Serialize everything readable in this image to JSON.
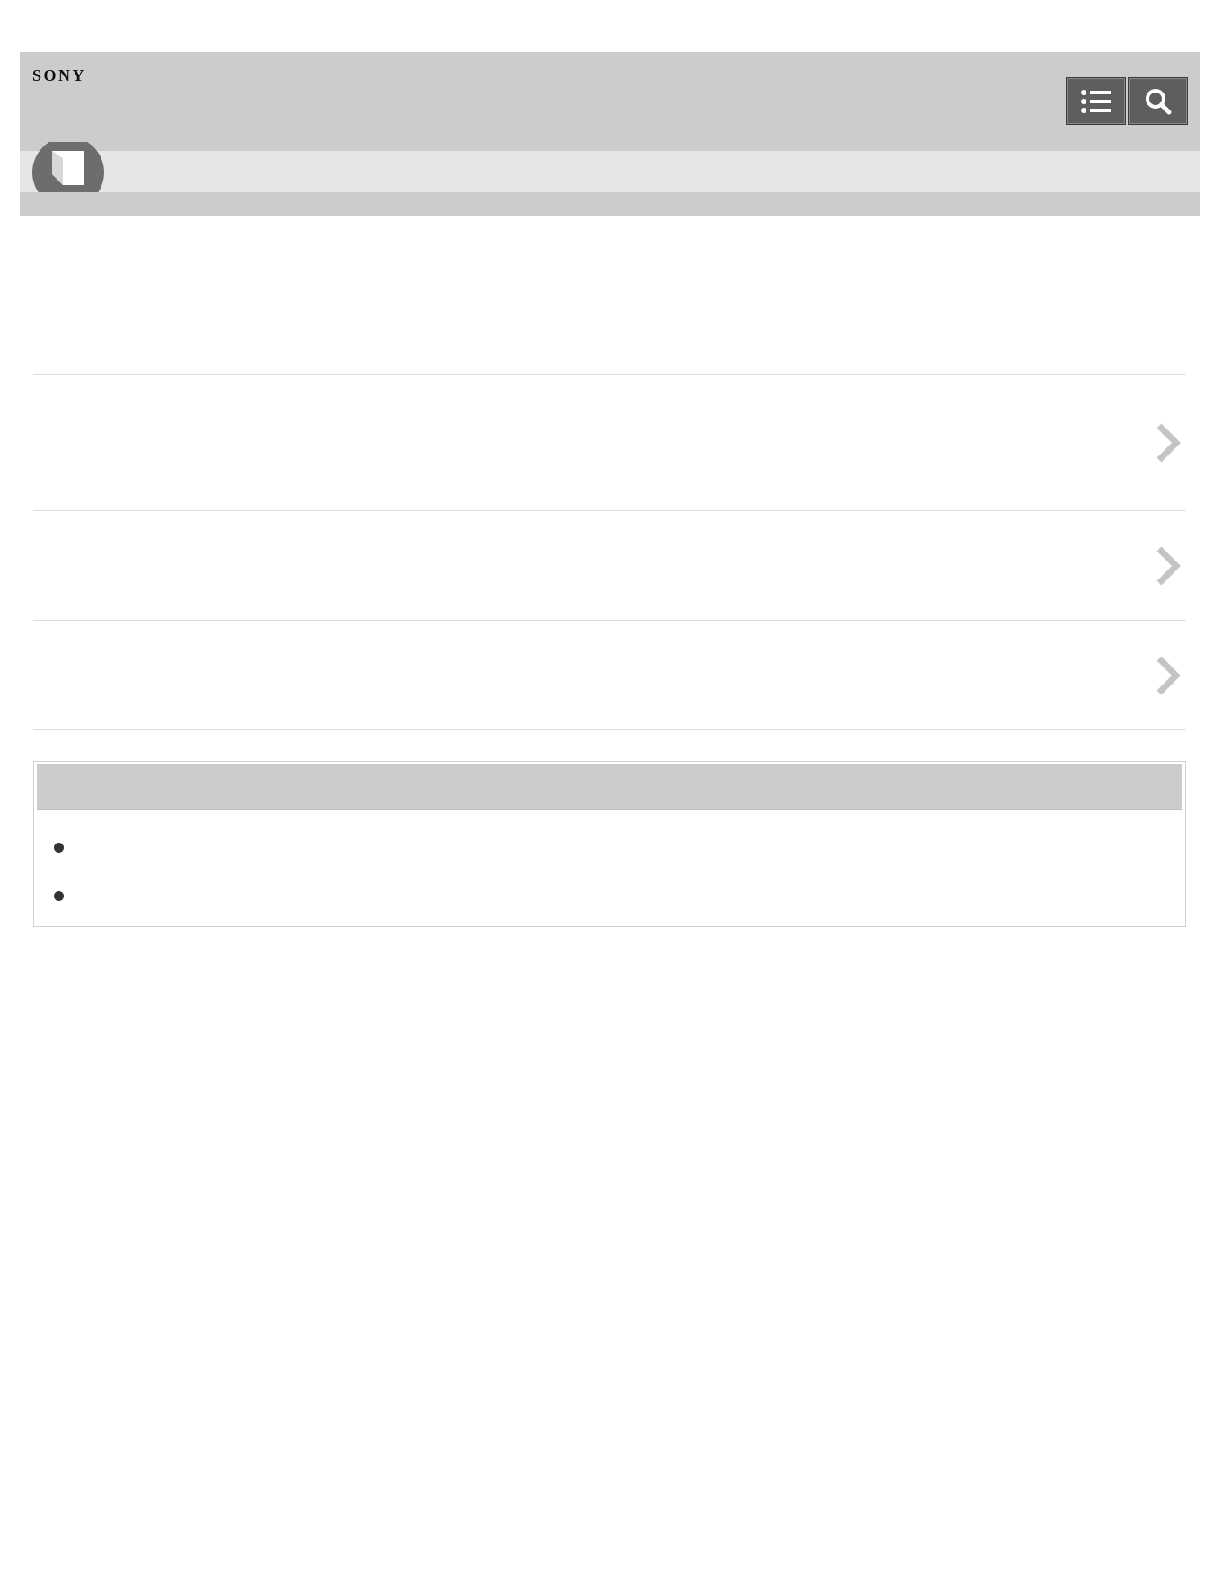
{
  "header": {
    "logo": "SONY",
    "toc_icon": "list-icon",
    "search_icon": "search-icon",
    "colors": {
      "bar": "#cccccc",
      "button": "#5e5e5e"
    }
  },
  "subbar": {
    "icon": "book-icon"
  },
  "page": {
    "title": "",
    "rows": [
      {
        "label": "",
        "icon": "chevron-right-icon"
      },
      {
        "label": "",
        "icon": "chevron-right-icon"
      },
      {
        "label": "",
        "icon": "chevron-right-icon"
      }
    ]
  },
  "note": {
    "title": "",
    "items": [
      {
        "text": ""
      },
      {
        "text": ""
      }
    ]
  }
}
